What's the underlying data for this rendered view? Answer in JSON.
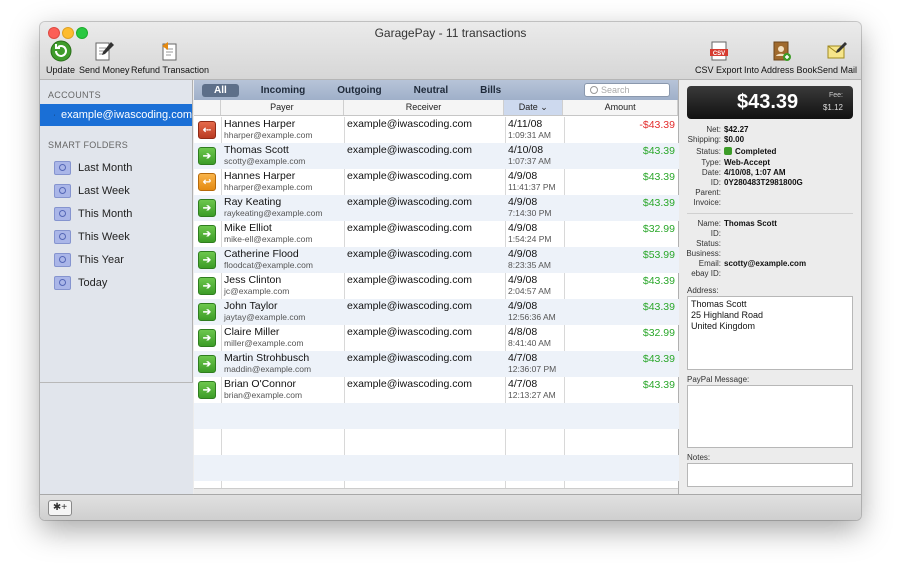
{
  "window": {
    "title": "GaragePay - 11 transactions"
  },
  "toolbar": {
    "update": "Update",
    "send_money": "Send Money",
    "refund": "Refund Transaction",
    "csv_export": "CSV Export",
    "address_book": "Into Address Book",
    "send_mail": "Send Mail"
  },
  "sidebar": {
    "accounts_header": "ACCOUNTS",
    "account": "example@iwascoding.com",
    "smart_header": "SMART FOLDERS",
    "folders": [
      "Last Month",
      "Last Week",
      "This Month",
      "This Week",
      "This Year",
      "Today"
    ]
  },
  "filters": [
    "All",
    "Incoming",
    "Outgoing",
    "Neutral",
    "Bills"
  ],
  "search": {
    "placeholder": "Search"
  },
  "columns": {
    "payer": "Payer",
    "receiver": "Receiver",
    "date": "Date",
    "amount": "Amount"
  },
  "transactions": [
    {
      "icon": "outgoing-red-icon",
      "name": "Hannes Harper",
      "email": "hharper@example.com",
      "receiver": "example@iwascoding.com",
      "date": "4/11/08",
      "time": "1:09:31 AM",
      "amount": "-$43.39",
      "sign": "neg"
    },
    {
      "icon": "incoming-green-icon",
      "name": "Thomas Scott",
      "email": "scotty@example.com",
      "receiver": "example@iwascoding.com",
      "date": "4/10/08",
      "time": "1:07:37 AM",
      "amount": "$43.39",
      "sign": "pos"
    },
    {
      "icon": "refund-orange-icon",
      "name": "Hannes Harper",
      "email": "hharper@example.com",
      "receiver": "example@iwascoding.com",
      "date": "4/9/08",
      "time": "11:41:37 PM",
      "amount": "$43.39",
      "sign": "pos"
    },
    {
      "icon": "incoming-green-icon",
      "name": "Ray Keating",
      "email": "raykeating@example.com",
      "receiver": "example@iwascoding.com",
      "date": "4/9/08",
      "time": "7:14:30 PM",
      "amount": "$43.39",
      "sign": "pos"
    },
    {
      "icon": "incoming-green-icon",
      "name": "Mike Elliot",
      "email": "mike-ell@example.com",
      "receiver": "example@iwascoding.com",
      "date": "4/9/08",
      "time": "1:54:24 PM",
      "amount": "$32.99",
      "sign": "pos"
    },
    {
      "icon": "incoming-green-icon",
      "name": "Catherine Flood",
      "email": "floodcat@example.com",
      "receiver": "example@iwascoding.com",
      "date": "4/9/08",
      "time": "8:23:35 AM",
      "amount": "$53.99",
      "sign": "pos"
    },
    {
      "icon": "incoming-green-icon",
      "name": "Jess Clinton",
      "email": "jc@example.com",
      "receiver": "example@iwascoding.com",
      "date": "4/9/08",
      "time": "2:04:57 AM",
      "amount": "$43.39",
      "sign": "pos"
    },
    {
      "icon": "incoming-green-icon",
      "name": "John Taylor",
      "email": "jaytay@example.com",
      "receiver": "example@iwascoding.com",
      "date": "4/9/08",
      "time": "12:56:36 AM",
      "amount": "$43.39",
      "sign": "pos"
    },
    {
      "icon": "incoming-green-icon",
      "name": "Claire Miller",
      "email": "miller@example.com",
      "receiver": "example@iwascoding.com",
      "date": "4/8/08",
      "time": "8:41:40 AM",
      "amount": "$32.99",
      "sign": "pos"
    },
    {
      "icon": "incoming-green-icon",
      "name": "Martin Strohbusch",
      "email": "maddin@example.com",
      "receiver": "example@iwascoding.com",
      "date": "4/7/08",
      "time": "12:36:07 PM",
      "amount": "$43.39",
      "sign": "pos"
    },
    {
      "icon": "incoming-green-icon",
      "name": "Brian O'Connor",
      "email": "brian@example.com",
      "receiver": "example@iwascoding.com",
      "date": "4/7/08",
      "time": "12:13:27 AM",
      "amount": "$43.39",
      "sign": "pos"
    }
  ],
  "detail": {
    "net_amount": "$43.39",
    "fee_label": "Fee:",
    "fee": "$1.12",
    "net_label": "Net:",
    "net": "$42.27",
    "shipping_label": "Shipping:",
    "shipping": "$0.00",
    "status_label": "Status:",
    "status": "Completed",
    "type_label": "Type:",
    "type": "Web-Accept",
    "date_label": "Date:",
    "date": "4/10/08, 1:07 AM",
    "id_label": "ID:",
    "id": "0Y280483T2981800G",
    "parent_label": "Parent:",
    "invoice_label": "Invoice:",
    "name_label": "Name:",
    "name": "Thomas Scott",
    "id2_label": "ID:",
    "status2_label": "Status:",
    "business_label": "Business:",
    "email_label": "Email:",
    "email": "scotty@example.com",
    "ebay_label": "ebay ID:",
    "address_label": "Address:",
    "address_lines": [
      "Thomas Scott",
      "25 Highland Road",
      "United Kingdom"
    ],
    "paypal_msg_label": "PayPal Message:",
    "notes_label": "Notes:"
  },
  "bottombar": {
    "action_button": "✱+"
  }
}
